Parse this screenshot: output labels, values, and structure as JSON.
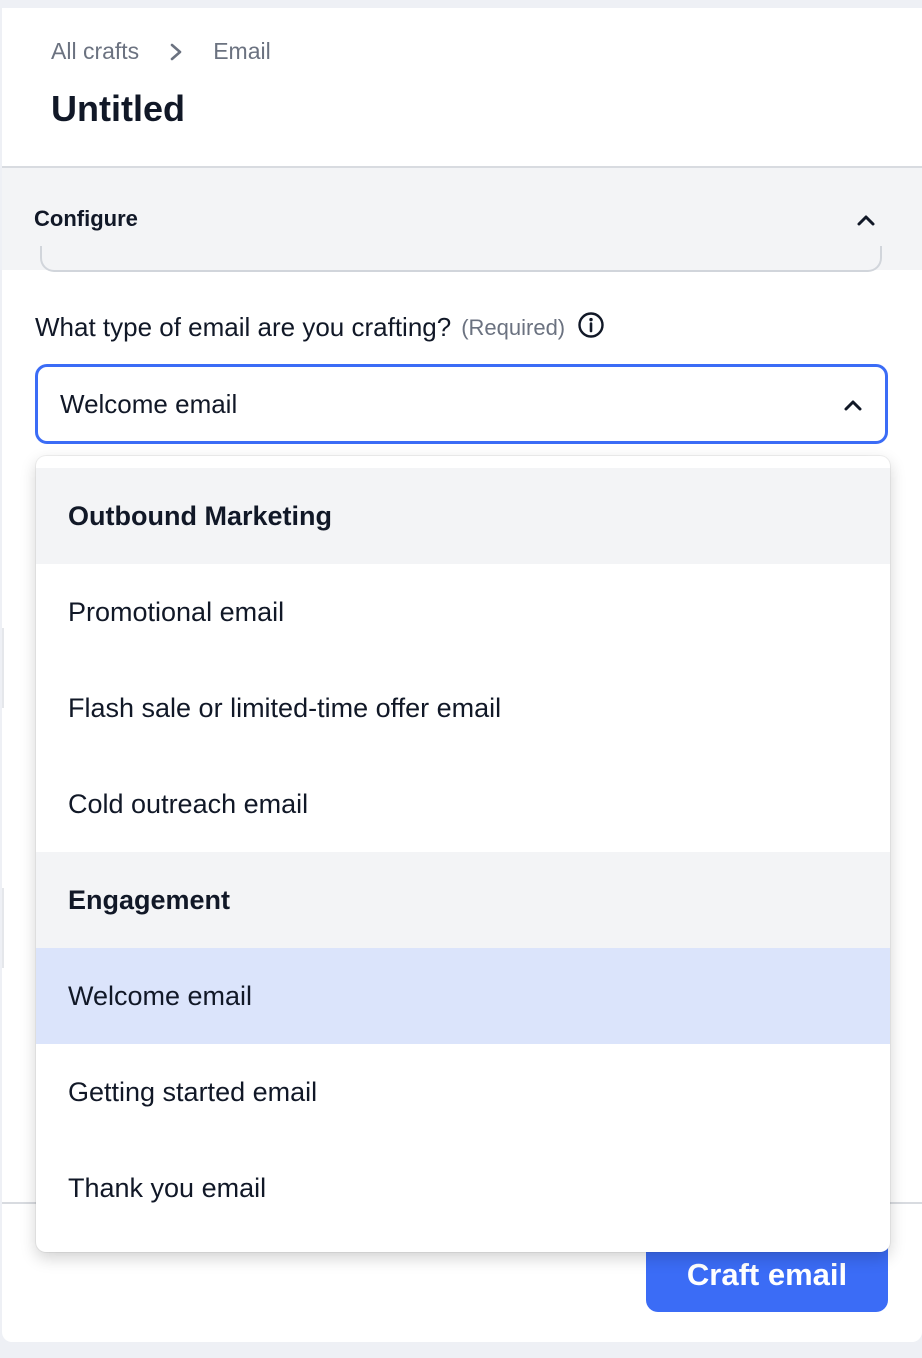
{
  "breadcrumb": {
    "root": "All crafts",
    "current": "Email"
  },
  "page_title": "Untitled",
  "configure": {
    "label": "Configure"
  },
  "question": {
    "label": "What type of email are you crafting?",
    "required": "(Required)"
  },
  "select": {
    "value": "Welcome email"
  },
  "dropdown": {
    "groups": [
      {
        "label": "Outbound Marketing",
        "options": [
          "Promotional email",
          "Flash sale or limited-time offer email",
          "Cold outreach email"
        ]
      },
      {
        "label": "Engagement",
        "options": [
          "Welcome email",
          "Getting started email",
          "Thank you email"
        ]
      }
    ],
    "selected": "Welcome email"
  },
  "footer": {
    "primary_button": "Craft email"
  },
  "colors": {
    "accent": "#3b6cf6",
    "selected_bg": "#dbe4fb",
    "group_bg": "#f3f4f6"
  },
  "icons": [
    "chevron-right-icon",
    "chevron-up-icon",
    "info-icon"
  ]
}
